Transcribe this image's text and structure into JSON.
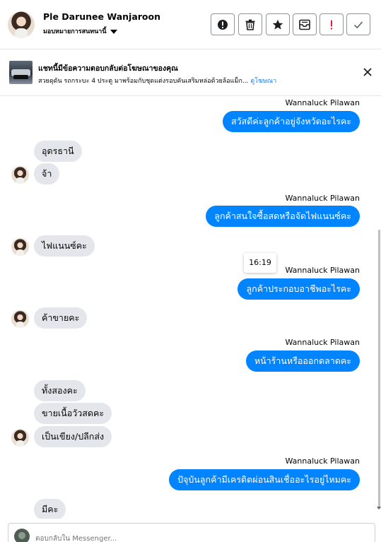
{
  "header": {
    "name": "Ple Darunee Wanjaroon",
    "subtitle": "มอบหมายการสนทนานี้"
  },
  "banner": {
    "title": "แชทนี้มีข้อความตอบกลับต่อโฆษณาของคุณ",
    "description": "สวยดุดัน รถกระบะ 4 ประตู มาพร้อมกับชุดแต่งรอบคันเสริมหล่อด้วยล้อแม็ก...",
    "link": "ดูโฆษณา"
  },
  "messages": {
    "m1_sender": "Wannaluck Pilawan",
    "m1_text": "สวัสดีค่ะลูกค้าอยู่จังหวัดอะไรคะ",
    "m2_text": "อุดรธานี",
    "m3_text": "จ้า",
    "m4_sender": "Wannaluck Pilawan",
    "m4_text": "ลูกค้าสนใจซื้อสดหรือจัดไฟแนนซ์คะ",
    "m5_text": "ไฟแนนซ์คะ",
    "time": "16:19",
    "m6_sender": "Wannaluck Pilawan",
    "m6_text": "ลูกค้าประกอบอาชีพอะไรคะ",
    "m7_text": "ค้าขายคะ",
    "m8_sender": "Wannaluck Pilawan",
    "m8_text": "หน้าร้านหรือออกตลาดคะ",
    "m9_text": "ทั้งสองคะ",
    "m10_text": "ขายเนื้อวัวสดคะ",
    "m11_text": "เป็นเขียง/ปลีกส่ง",
    "m12_sender": "Wannaluck Pilawan",
    "m12_text": "ปัจุบันลูกค้ามีเครดิตผ่อนสินเชื่ออะไรอยู่ไหมคะ",
    "m13_text": "มีคะ"
  },
  "composer": {
    "placeholder": "ตอบกลับใน Messenger..."
  },
  "colors": {
    "outgoing_bubble": "#0084ff",
    "incoming_bubble": "#e4e6eb",
    "link": "#1877f2",
    "alert_red": "#e41e3f"
  },
  "icons": [
    "info-icon",
    "trash-icon",
    "star-icon",
    "archive-icon",
    "exclamation-icon",
    "check-icon",
    "close-icon"
  ]
}
